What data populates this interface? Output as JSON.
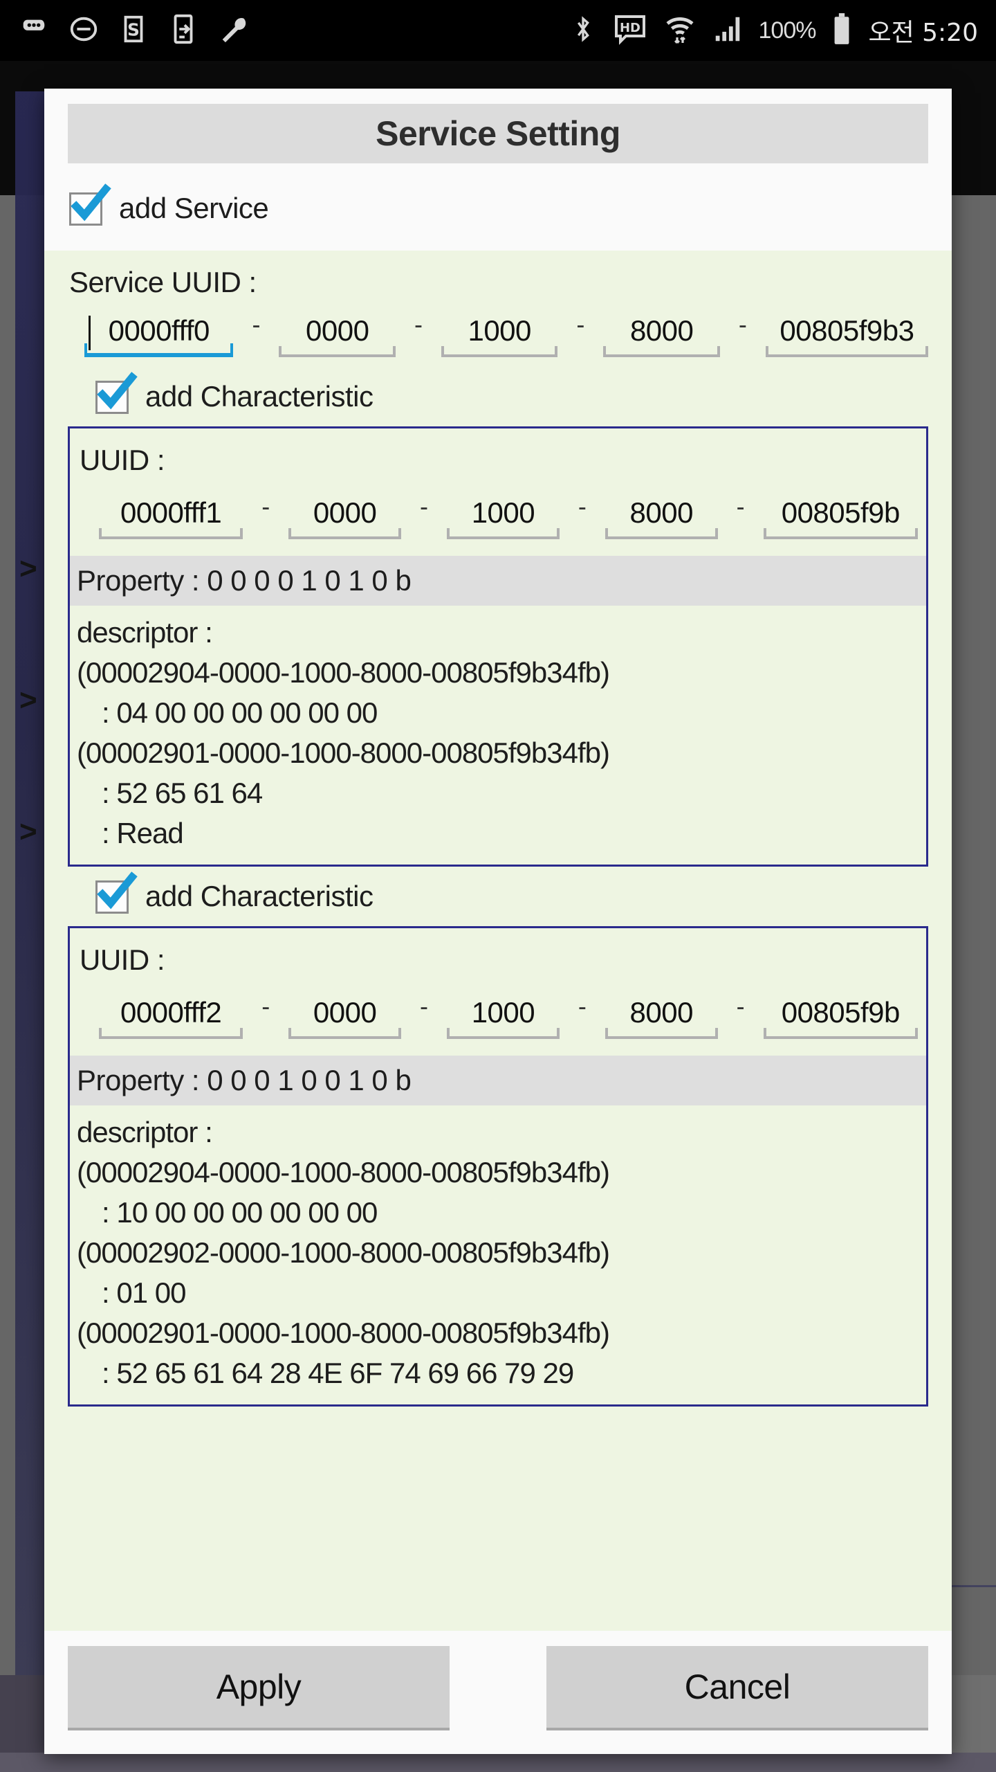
{
  "statusbar": {
    "left_icons": [
      "more-dots-icon",
      "do-not-disturb-icon",
      "s-badge-icon",
      "phone-transfer-icon",
      "wrench-icon"
    ],
    "right_icons": [
      "bluetooth-icon",
      "hd-icon",
      "wifi-icon",
      "signal-bars-icon",
      "battery-icon"
    ],
    "battery_percent": "100%",
    "clock": "오전 5:20"
  },
  "dialog": {
    "title": "Service Setting",
    "add_service": {
      "label": "add Service",
      "checked": true
    },
    "service_uuid": {
      "label": "Service UUID :",
      "dash": "-",
      "segments": [
        "0000fff0",
        "0000",
        "1000",
        "8000",
        "00805f9b3"
      ],
      "focused_index": 0
    },
    "characteristics": [
      {
        "checkbox_label": "add Characteristic",
        "checked": true,
        "uuid_label": "UUID :",
        "uuid_segments": [
          "0000fff1",
          "0000",
          "1000",
          "8000",
          "00805f9b"
        ],
        "property": "Property :  0 0 0 0 1 0 1 0 b",
        "descriptor_label": "descriptor :",
        "descriptor_lines": [
          {
            "text": "(00002904-0000-1000-8000-00805f9b34fb)",
            "indent": false
          },
          {
            "text": ": 04 00 00 00 00 00 00",
            "indent": true
          },
          {
            "text": "(00002901-0000-1000-8000-00805f9b34fb)",
            "indent": false
          },
          {
            "text": ": 52 65 61 64",
            "indent": true
          },
          {
            "text": ": Read",
            "indent": true
          }
        ]
      },
      {
        "checkbox_label": "add Characteristic",
        "checked": true,
        "uuid_label": "UUID :",
        "uuid_segments": [
          "0000fff2",
          "0000",
          "1000",
          "8000",
          "00805f9b"
        ],
        "property": "Property :  0 0 0 1 0 0 1 0 b",
        "descriptor_label": "descriptor :",
        "descriptor_lines": [
          {
            "text": "(00002904-0000-1000-8000-00805f9b34fb)",
            "indent": false
          },
          {
            "text": ": 10 00 00 00 00 00 00",
            "indent": true
          },
          {
            "text": "(00002902-0000-1000-8000-00805f9b34fb)",
            "indent": false
          },
          {
            "text": ": 01 00",
            "indent": true
          },
          {
            "text": "(00002901-0000-1000-8000-00805f9b34fb)",
            "indent": false
          },
          {
            "text": ": 52 65 61 64 28 4E 6F 74 69 66 79 29",
            "indent": true
          }
        ]
      }
    ],
    "buttons": {
      "apply": "Apply",
      "cancel": "Cancel"
    }
  },
  "background": {
    "chevron": ">",
    "chevron_count": 3
  },
  "colors": {
    "accent_blue": "#1a9ad6",
    "panel_border": "#2a2a8c",
    "content_bg": "#eef5e2",
    "property_bg": "#dedede",
    "title_bg": "#dcdcdc",
    "dialog_bg": "#fafafa",
    "button_bg": "#d0d0d0"
  }
}
